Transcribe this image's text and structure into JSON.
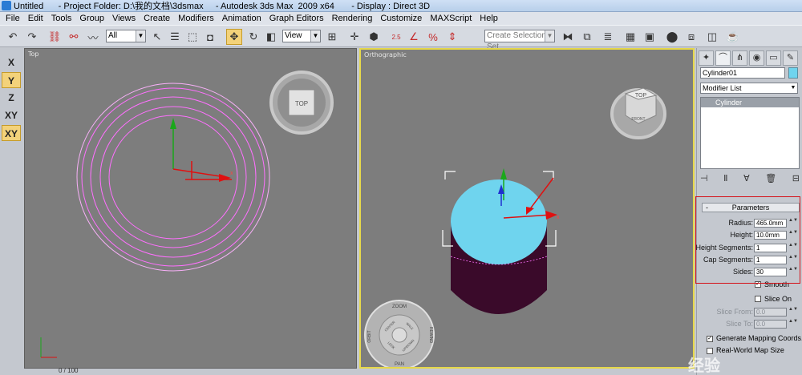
{
  "window": {
    "title": "Untitled      - Project Folder: D:\\我的文档\\3dsmax     - Autodesk 3ds Max  2009 x64       - Display : Direct 3D"
  },
  "menu": [
    "File",
    "Edit",
    "Tools",
    "Group",
    "Views",
    "Create",
    "Modifiers",
    "Animation",
    "Graph Editors",
    "Rendering",
    "Customize",
    "MAXScript",
    "Help"
  ],
  "toolbar": {
    "selection_filter": "All",
    "coord_system": "View",
    "named_selection_placeholder": "Create Selection Set",
    "snap_label": "2.5"
  },
  "axis_constraints": [
    "X",
    "Y",
    "Z",
    "XY",
    "XY"
  ],
  "viewports": {
    "top": {
      "label": "Top",
      "viewcube": "TOP"
    },
    "persp": {
      "label": "Orthographic",
      "viewcube_top": "TOP",
      "viewcube_front": "FRONT"
    },
    "wheel": {
      "zoom": "ZOOM",
      "orbit": "ORBIT",
      "pan": "PAN",
      "rewind": "REWIND",
      "center": "CENTER",
      "walk": "WALK",
      "look": "LOOK",
      "updown": "UP/DOWN"
    },
    "axis_x": "x",
    "status_left": "0 / 100"
  },
  "command_panel": {
    "object_name": "Cylinder01",
    "object_color": "#6fd4ee",
    "modifier_list": "Modifier List",
    "stack_item": "Cylinder",
    "rollout_title": "Parameters",
    "params": {
      "radius_label": "Radius:",
      "radius": "465.0mm",
      "height_label": "Height:",
      "height": "10.0mm",
      "height_segments_label": "Height Segments:",
      "height_segments": "1",
      "cap_segments_label": "Cap Segments:",
      "cap_segments": "1",
      "sides_label": "Sides:",
      "sides": "30"
    },
    "smooth_label": "Smooth",
    "slice_on_label": "Slice On",
    "slice_from_label": "Slice From:",
    "slice_from": "0.0",
    "slice_to_label": "Slice To:",
    "slice_to": "0.0",
    "gen_mapping_label": "Generate Mapping Coords.",
    "real_world_label": "Real-World Map Size"
  },
  "watermark": "经验"
}
